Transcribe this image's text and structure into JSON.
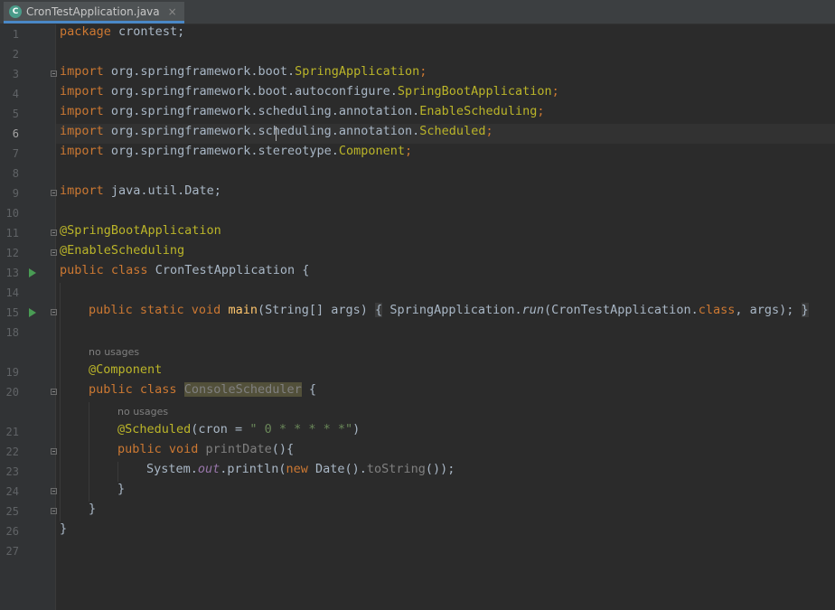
{
  "tab": {
    "file_name": "CronTestApplication.java",
    "close_glyph": "×",
    "icon": "class-c-icon"
  },
  "current_line": 6,
  "line_numbers": [
    "1",
    "2",
    "3",
    "4",
    "5",
    "6",
    "7",
    "8",
    "9",
    "10",
    "11",
    "12",
    "13",
    "14",
    "15",
    "18",
    "19",
    "20",
    "21",
    "22",
    "23",
    "24",
    "25",
    "26",
    "27"
  ],
  "hints": {
    "usages_1": "no usages",
    "usages_2": "no usages"
  },
  "code": {
    "l1_kw": "package",
    "l1_rest": "crontest;",
    "l3_kw": "import",
    "l3_pkg": "org.springframework.boot.",
    "l3_cls": "SpringApplication",
    "l3_end": ";",
    "l4_kw": "import",
    "l4_pkg": "org.springframework.boot.autoconfigure.",
    "l4_cls": "SpringBootApplication",
    "l4_end": ";",
    "l5_kw": "import",
    "l5_pkg": "org.springframework.scheduling.annotation.",
    "l5_cls": "EnableScheduling",
    "l5_end": ";",
    "l6_kw": "import",
    "l6_pkg": "org.springframework.scheduling.annotation.",
    "l6_cls": "Scheduled",
    "l6_end": ";",
    "l7_kw": "import",
    "l7_pkg": "org.springframework.stereotype.",
    "l7_cls": "Component",
    "l7_end": ";",
    "l9_kw": "import",
    "l9_rest": "java.util.Date;",
    "l11": "@SpringBootApplication",
    "l12": "@EnableScheduling",
    "l13_kw": "public class",
    "l13_name": "CronTestApplication",
    "l13_brace": "{",
    "l15_kw": "public static void",
    "l15_main": "main",
    "l15_params": "(String[] args)",
    "l15_ob": "{",
    "l15_body": "SpringApplication.",
    "l15_run": "run",
    "l15_args1": "(CronTestApplication.",
    "l15_class": "class",
    "l15_args2": ", args);",
    "l15_cb": "}",
    "l19": "@Component",
    "l20_kw": "public class",
    "l20_name": "ConsoleScheduler",
    "l20_brace": "{",
    "l21_an": "@Scheduled",
    "l21_open": "(cron = ",
    "l21_str": "\" 0 * * * * *\"",
    "l21_close": ")",
    "l22_kw": "public void",
    "l22_name": "printDate",
    "l22_rest": "(){",
    "l23_a": "System.",
    "l23_out": "out",
    "l23_b": ".println(",
    "l23_new": "new",
    "l23_c": "Date().",
    "l23_ts": "toString",
    "l23_d": "());",
    "l24": "}",
    "l25": "}",
    "l26": "}"
  },
  "colors": {
    "background": "#2b2b2b",
    "keyword": "#cc7832",
    "annotation": "#bbb529",
    "method": "#ffc66d",
    "string": "#6a8759",
    "static_field": "#9876aa",
    "run_marker": "#499c54"
  }
}
